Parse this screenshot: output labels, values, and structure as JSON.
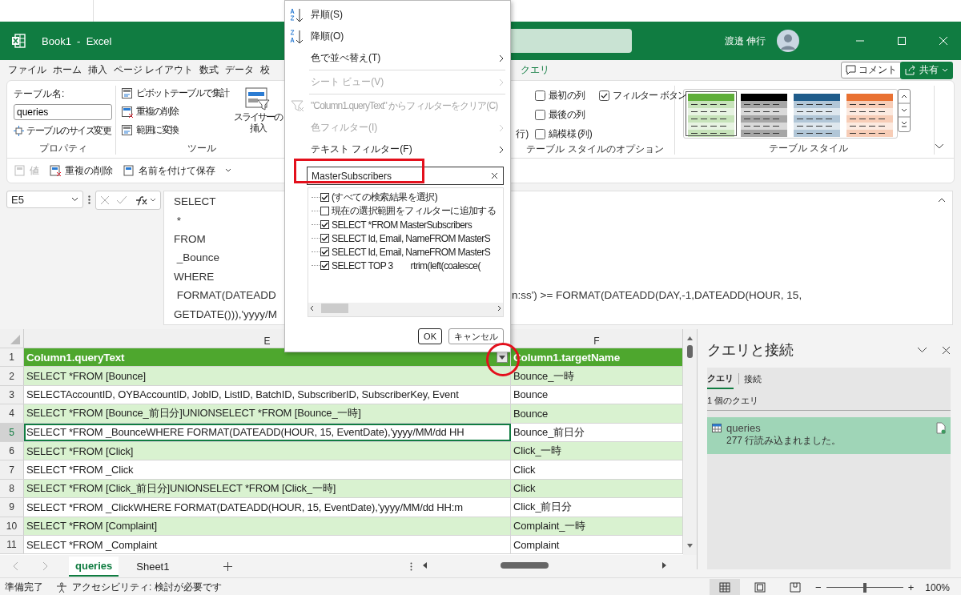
{
  "window": {
    "title": "Book1  -  Excel",
    "user": "渡邉 伸行"
  },
  "menu_tabs": [
    "ファイル",
    "ホーム",
    "挿入",
    "ページ レイアウト",
    "数式",
    "データ",
    "校"
  ],
  "context_tab": "クエリ",
  "header_buttons": {
    "comment": "コメント",
    "share": "共有"
  },
  "ribbon": {
    "properties": {
      "table_name_label": "テーブル名:",
      "table_name": "queries",
      "resize": "テーブルのサイズ変更",
      "group": "プロパティ"
    },
    "tools": {
      "items": [
        "ピボットテーブルで集計",
        "重複の削除",
        "範囲に変換"
      ],
      "slicer": [
        "スライサーの",
        "挿入"
      ],
      "group": "ツール"
    },
    "style_options": {
      "partial": "行)",
      "checkboxes": [
        {
          "label": "最初の列",
          "checked": false
        },
        {
          "label": "最後の列",
          "checked": false
        },
        {
          "label": "縞模様 (列)",
          "checked": false
        },
        {
          "label": "フィルター ボタン",
          "checked": true
        }
      ],
      "group": "テーブル スタイルのオプション"
    },
    "table_styles": {
      "swatches": [
        {
          "color": "#5fae3a",
          "selected": true
        },
        {
          "color": "#000000",
          "selected": false
        },
        {
          "color": "#1f5c8b",
          "selected": false
        },
        {
          "color": "#e97132",
          "selected": false
        }
      ],
      "group": "テーブル スタイル"
    }
  },
  "quick_access": [
    {
      "label": "値",
      "disabled": true
    },
    {
      "label": "重複の削除",
      "disabled": false
    },
    {
      "label": "名前を付けて保存",
      "disabled": false
    }
  ],
  "formula_bar": {
    "cell": "E5",
    "lines": [
      {
        "text": "SELECT"
      },
      {
        "text": " *"
      },
      {
        "text": "FROM"
      },
      {
        "text": " _Bounce"
      },
      {
        "text": "WHERE"
      },
      {
        "text": " FORMAT(DATEADD",
        "continuation": "n:ss') >= FORMAT(DATEADD(DAY,-1,DATEADD(HOUR, 15,"
      },
      {
        "text": "GETDATE())),'yyyy/M"
      }
    ]
  },
  "sheet": {
    "columns": [
      "E",
      "F"
    ],
    "header_row": "1",
    "header": [
      "Column1.queryText",
      "Column1.targetName"
    ],
    "rows": [
      {
        "num": "2",
        "selected": false,
        "cells": [
          "SELECT *FROM [Bounce]",
          "Bounce_一時"
        ]
      },
      {
        "num": "3",
        "selected": false,
        "cells": [
          "SELECTAccountID, OYBAccountID, JobID, ListID, BatchID, SubscriberID, SubscriberKey, Event",
          "Bounce"
        ]
      },
      {
        "num": "4",
        "selected": false,
        "cells": [
          "SELECT *FROM [Bounce_前日分]UNIONSELECT *FROM [Bounce_一時]",
          "Bounce"
        ]
      },
      {
        "num": "5",
        "selected": true,
        "cells": [
          "SELECT *FROM _BounceWHERE FORMAT(DATEADD(HOUR, 15, EventDate),'yyyy/MM/dd HH",
          "Bounce_前日分"
        ]
      },
      {
        "num": "6",
        "selected": false,
        "cells": [
          "SELECT *FROM [Click]",
          "Click_一時"
        ]
      },
      {
        "num": "7",
        "selected": false,
        "cells": [
          "SELECT *FROM _Click",
          "Click"
        ]
      },
      {
        "num": "8",
        "selected": false,
        "cells": [
          "SELECT *FROM [Click_前日分]UNIONSELECT *FROM [Click_一時]",
          "Click"
        ]
      },
      {
        "num": "9",
        "selected": false,
        "cells": [
          "SELECT *FROM _ClickWHERE FORMAT(DATEADD(HOUR, 15, EventDate),'yyyy/MM/dd HH:m",
          "Click_前日分"
        ]
      },
      {
        "num": "10",
        "selected": false,
        "cells": [
          "SELECT *FROM [Complaint]",
          "Complaint_一時"
        ]
      },
      {
        "num": "11",
        "selected": false,
        "cells": [
          "SELECT *FROM _Complaint",
          "Complaint"
        ]
      }
    ]
  },
  "sheet_tabs": [
    {
      "label": "queries",
      "selected": true
    },
    {
      "label": "Sheet1",
      "selected": false
    }
  ],
  "status": {
    "ready": "準備完了",
    "accessibility": "アクセシビリティ: 検討が必要です",
    "zoom_out": "−",
    "zoom_in": "+",
    "zoom": "100%",
    "level": 0.5
  },
  "queries_pane": {
    "title": "クエリと接続",
    "tabs": [
      {
        "label": "クエリ",
        "selected": true
      },
      {
        "label": "接続",
        "selected": false
      }
    ],
    "count": "1 個のクエリ",
    "items": [
      {
        "name": "queries",
        "status": "277 行読み込まれました。",
        "selected": true
      }
    ]
  },
  "filter_menu": {
    "items": [
      {
        "kind": "sort_asc",
        "label": "昇順(S)",
        "disabled": false
      },
      {
        "kind": "sort_desc",
        "label": "降順(O)",
        "disabled": false
      },
      {
        "kind": "submenu",
        "label": "色で並べ替え(T)",
        "disabled": false
      },
      {
        "kind": "separator"
      },
      {
        "kind": "submenu",
        "label": "シート ビュー(V)",
        "disabled": true
      },
      {
        "kind": "separator"
      },
      {
        "kind": "clear",
        "label": "\"Column1.queryText\" からフィルターをクリア(C)",
        "disabled": true
      },
      {
        "kind": "submenu",
        "label": "色フィルター(I)",
        "disabled": true
      },
      {
        "kind": "submenu",
        "label": "テキスト フィルター(F)",
        "disabled": false
      }
    ],
    "search": {
      "value": "MasterSubscribers"
    },
    "values": [
      {
        "label": "(すべての検索結果を選択)",
        "checked": true
      },
      {
        "label": "現在の選択範囲をフィルターに追加する",
        "checked": false
      },
      {
        "label": "SELECT *FROM MasterSubscribers",
        "checked": true
      },
      {
        "label": "SELECT Id, Email, NameFROM MasterS",
        "checked": true
      },
      {
        "label": "SELECT Id, Email, NameFROM MasterS",
        "checked": true
      },
      {
        "label": "SELECT TOP 3        rtrim(left(coalesce(",
        "checked": true
      }
    ],
    "buttons": {
      "ok": "OK",
      "cancel": "キャンセル"
    }
  }
}
